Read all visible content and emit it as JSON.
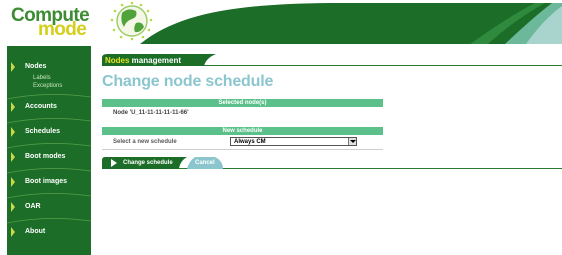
{
  "app": {
    "logo_word1": "Compute",
    "logo_word2": "mode",
    "colors": {
      "header_green": "#1b6d27",
      "accent_teal": "#8bc6cf",
      "bar_green": "#5cc08a",
      "brand_yellow": "#d4cf1a"
    }
  },
  "sidebar": {
    "items": [
      {
        "label": "Nodes",
        "icon": "arrow-right-icon"
      },
      {
        "label": "Accounts",
        "icon": "arrow-right-icon"
      },
      {
        "label": "Schedules",
        "icon": "arrow-right-icon"
      },
      {
        "label": "Boot modes",
        "icon": "arrow-right-icon"
      },
      {
        "label": "Boot images",
        "icon": "arrow-right-icon"
      },
      {
        "label": "OAR",
        "icon": "arrow-right-icon"
      },
      {
        "label": "About",
        "icon": "arrow-right-icon"
      }
    ],
    "subitems": [
      {
        "label": "Labels"
      },
      {
        "label": "Exceptions"
      }
    ]
  },
  "main": {
    "section_tab_part1": "Nodes",
    "section_tab_part2": " management",
    "page_title": "Change node schedule",
    "selected_header": "Selected node(s)",
    "selected_node": "Node 'U_11-11-11-11-11-66'",
    "schedule_header": "New schedule",
    "schedule_label": "Select a new schedule",
    "schedule_value": "Always CM",
    "change_button": "Change schedule",
    "cancel_button": "Cancel"
  }
}
